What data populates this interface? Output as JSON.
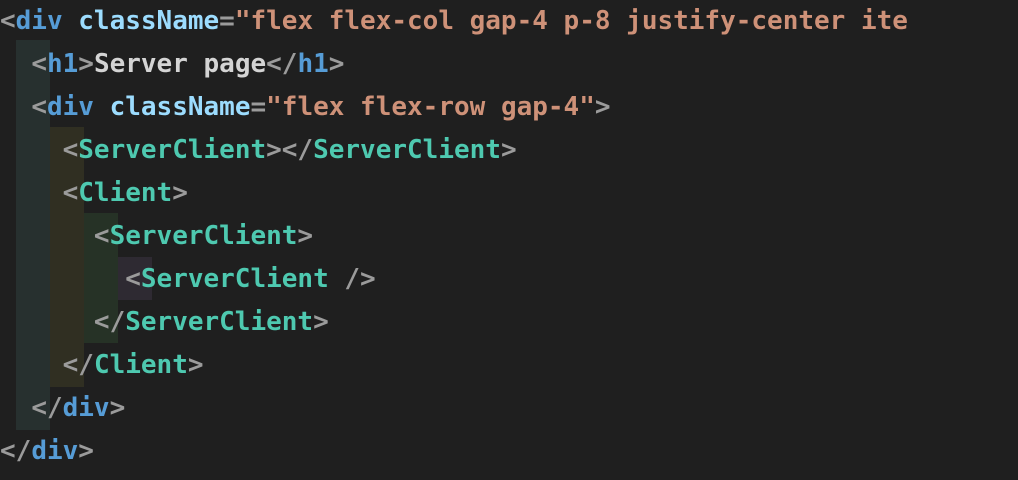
{
  "editor": {
    "language": "tsx",
    "lines": [
      [
        {
          "t": "<",
          "k": "punct"
        },
        {
          "t": "div",
          "k": "tag"
        },
        {
          "t": " ",
          "k": "text"
        },
        {
          "t": "className",
          "k": "attr"
        },
        {
          "t": "=",
          "k": "punct"
        },
        {
          "t": "\"flex flex-col gap-4 p-8 justify-center ite",
          "k": "str"
        }
      ],
      [
        {
          "t": "  ",
          "k": "text"
        },
        {
          "t": "<",
          "k": "punct"
        },
        {
          "t": "h1",
          "k": "tag"
        },
        {
          "t": ">",
          "k": "punct"
        },
        {
          "t": "Server page",
          "k": "text"
        },
        {
          "t": "</",
          "k": "punct"
        },
        {
          "t": "h1",
          "k": "tag"
        },
        {
          "t": ">",
          "k": "punct"
        }
      ],
      [
        {
          "t": "  ",
          "k": "text"
        },
        {
          "t": "<",
          "k": "punct"
        },
        {
          "t": "div",
          "k": "tag"
        },
        {
          "t": " ",
          "k": "text"
        },
        {
          "t": "className",
          "k": "attr"
        },
        {
          "t": "=",
          "k": "punct"
        },
        {
          "t": "\"flex flex-row gap-4\"",
          "k": "str"
        },
        {
          "t": ">",
          "k": "punct"
        }
      ],
      [
        {
          "t": "    ",
          "k": "text"
        },
        {
          "t": "<",
          "k": "punct"
        },
        {
          "t": "ServerClient",
          "k": "comp"
        },
        {
          "t": "></",
          "k": "punct"
        },
        {
          "t": "ServerClient",
          "k": "comp"
        },
        {
          "t": ">",
          "k": "punct"
        }
      ],
      [
        {
          "t": "    ",
          "k": "text"
        },
        {
          "t": "<",
          "k": "punct"
        },
        {
          "t": "Client",
          "k": "comp"
        },
        {
          "t": ">",
          "k": "punct"
        }
      ],
      [
        {
          "t": "      ",
          "k": "text"
        },
        {
          "t": "<",
          "k": "punct"
        },
        {
          "t": "ServerClient",
          "k": "comp"
        },
        {
          "t": ">",
          "k": "punct"
        }
      ],
      [
        {
          "t": "        ",
          "k": "text"
        },
        {
          "t": "<",
          "k": "punct"
        },
        {
          "t": "ServerClient",
          "k": "comp"
        },
        {
          "t": " />",
          "k": "punct"
        }
      ],
      [
        {
          "t": "      ",
          "k": "text"
        },
        {
          "t": "</",
          "k": "punct"
        },
        {
          "t": "ServerClient",
          "k": "comp"
        },
        {
          "t": ">",
          "k": "punct"
        }
      ],
      [
        {
          "t": "    ",
          "k": "text"
        },
        {
          "t": "</",
          "k": "punct"
        },
        {
          "t": "Client",
          "k": "comp"
        },
        {
          "t": ">",
          "k": "punct"
        }
      ],
      [
        {
          "t": "  ",
          "k": "text"
        },
        {
          "t": "</",
          "k": "punct"
        },
        {
          "t": "div",
          "k": "tag"
        },
        {
          "t": ">",
          "k": "punct"
        }
      ],
      [
        {
          "t": "</",
          "k": "punct"
        },
        {
          "t": "div",
          "k": "tag"
        },
        {
          "t": ">",
          "k": "punct"
        }
      ]
    ]
  }
}
